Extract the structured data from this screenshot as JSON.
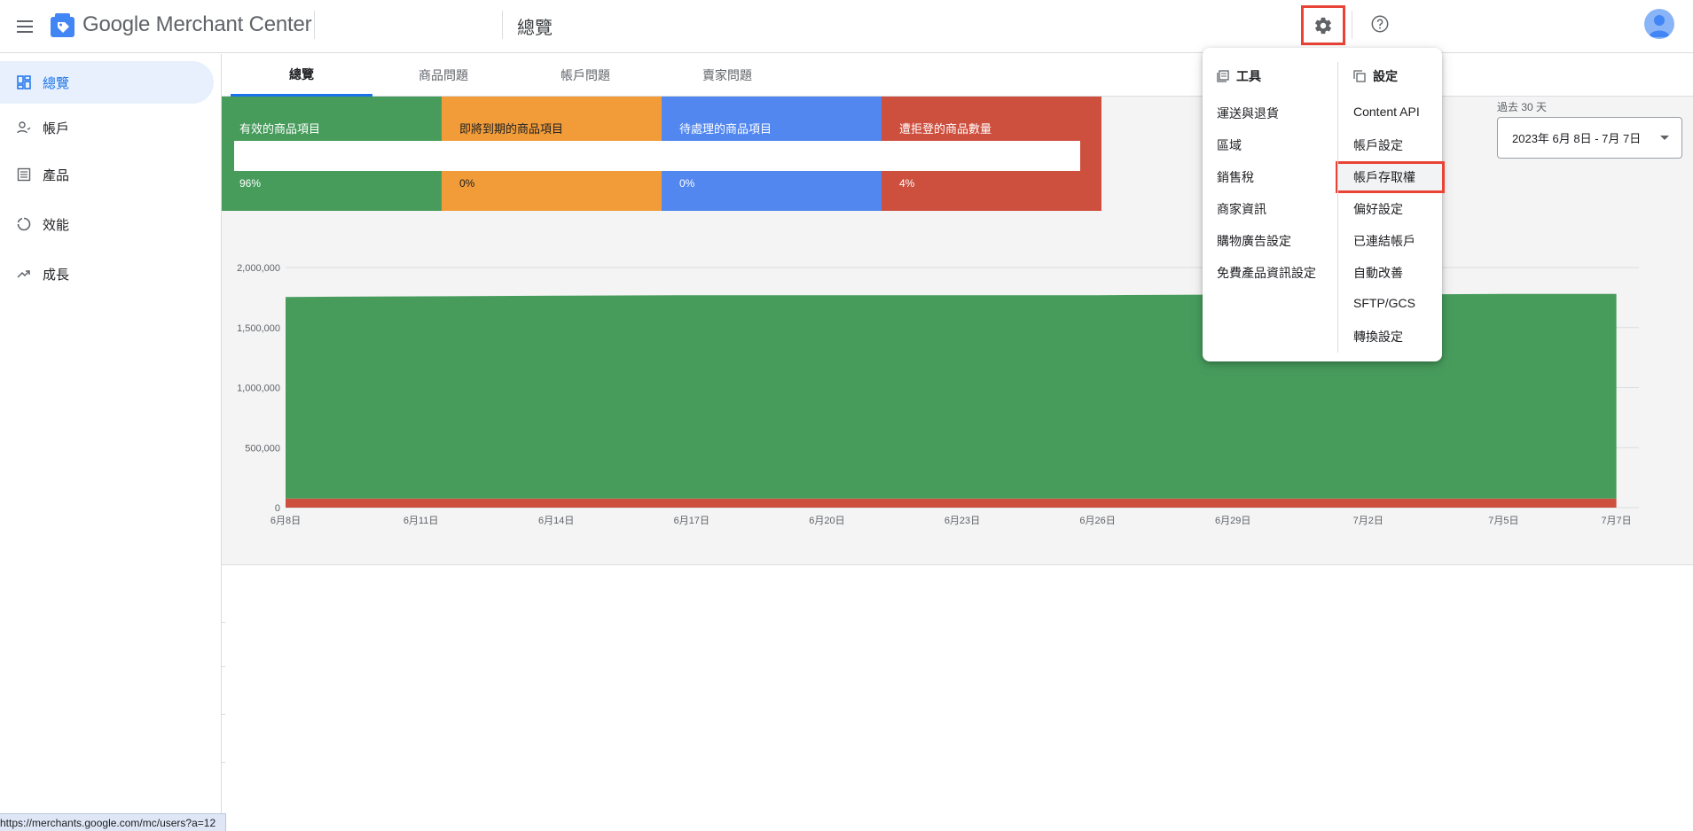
{
  "header": {
    "brand": "Google Merchant Center",
    "page_title": "總覽",
    "icons": [
      "menu-icon",
      "merchant-logo-icon",
      "gear-icon",
      "help-icon",
      "avatar"
    ]
  },
  "sidebar": {
    "items": [
      {
        "label": "總覽",
        "icon": "dashboard-icon",
        "active": true
      },
      {
        "label": "帳戶",
        "icon": "account-icon",
        "active": false
      },
      {
        "label": "產品",
        "icon": "products-icon",
        "active": false
      },
      {
        "label": "效能",
        "icon": "performance-icon",
        "active": false
      },
      {
        "label": "成長",
        "icon": "growth-icon",
        "active": false
      }
    ],
    "status_url": "https://merchants.google.com/mc/users?a=12"
  },
  "tabs": [
    {
      "label": "總覽",
      "active": true
    },
    {
      "label": "商品問題",
      "active": false
    },
    {
      "label": "帳戶問題",
      "active": false
    },
    {
      "label": "賣家問題",
      "active": false
    }
  ],
  "cards": [
    {
      "label": "有效的商品項目",
      "percent": "96%",
      "color": "#479c5c"
    },
    {
      "label": "即將到期的商品項目",
      "percent": "0%",
      "color": "#f19c38"
    },
    {
      "label": "待處理的商品項目",
      "percent": "0%",
      "color": "#5187ef"
    },
    {
      "label": "遭拒登的商品數量",
      "percent": "4%",
      "color": "#cd4f3e"
    }
  ],
  "date_range": {
    "label": "過去 30 天",
    "value": "2023年 6月 8日 - 7月 7日"
  },
  "popup": {
    "tools": {
      "heading": "工具",
      "items": [
        "運送與退貨",
        "區域",
        "銷售稅",
        "商家資訊",
        "購物廣告設定",
        "免費產品資訊設定"
      ]
    },
    "settings": {
      "heading": "設定",
      "items": [
        "Content API",
        "帳戶設定",
        "帳戶存取權",
        "偏好設定",
        "已連結帳戶",
        "自動改善",
        "SFTP/GCS",
        "轉換設定"
      ],
      "highlighted": "帳戶存取權"
    }
  },
  "chart_data": {
    "type": "area",
    "x": [
      "6月8日",
      "6月11日",
      "6月14日",
      "6月17日",
      "6月20日",
      "6月23日",
      "6月26日",
      "6月29日",
      "7月2日",
      "7月5日",
      "7月7日"
    ],
    "ytick_labels": [
      "0",
      "500,000",
      "1,000,000",
      "1,500,000",
      "2,000,000"
    ],
    "ylim": [
      0,
      2000000
    ],
    "series": [
      {
        "color": "#cd4f3e",
        "values": [
          75000,
          75000,
          75000,
          75000,
          75000,
          75000,
          75000,
          75000,
          75000,
          75000,
          75000
        ]
      },
      {
        "color": "#479c5c",
        "values": [
          1680000,
          1685000,
          1690000,
          1695000,
          1695000,
          1695000,
          1695000,
          1700000,
          1700000,
          1705000,
          1705000
        ]
      }
    ],
    "grid": true
  }
}
